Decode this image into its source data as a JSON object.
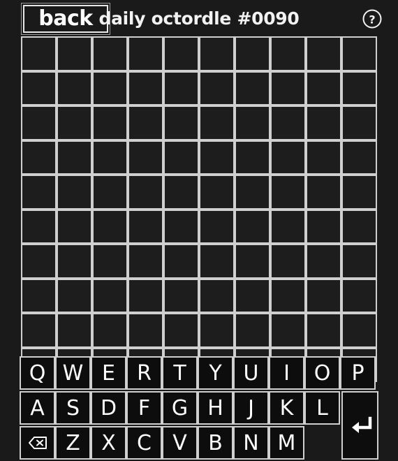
{
  "header": {
    "back_label": "back",
    "title": "daily octordle #0090",
    "help_icon": "question-mark-circle-icon"
  },
  "board": {
    "columns": 10,
    "rows": 10,
    "cells_filled": false,
    "cell_letters": []
  },
  "keyboard": {
    "row1": [
      "Q",
      "W",
      "E",
      "R",
      "T",
      "Y",
      "U",
      "I",
      "O",
      "P"
    ],
    "row2": [
      "A",
      "S",
      "D",
      "F",
      "G",
      "H",
      "J",
      "K",
      "L"
    ],
    "row3": [
      "Z",
      "X",
      "C",
      "V",
      "B",
      "N",
      "M"
    ],
    "backspace_icon": "backspace-icon",
    "enter_icon": "enter-return-icon"
  },
  "colors": {
    "background": "#1a1a1a",
    "cell_border": "#cfcfcf",
    "cell_fill": "#1d1d1d",
    "key_fill": "#0d0d0d",
    "text": "#ffffff"
  }
}
